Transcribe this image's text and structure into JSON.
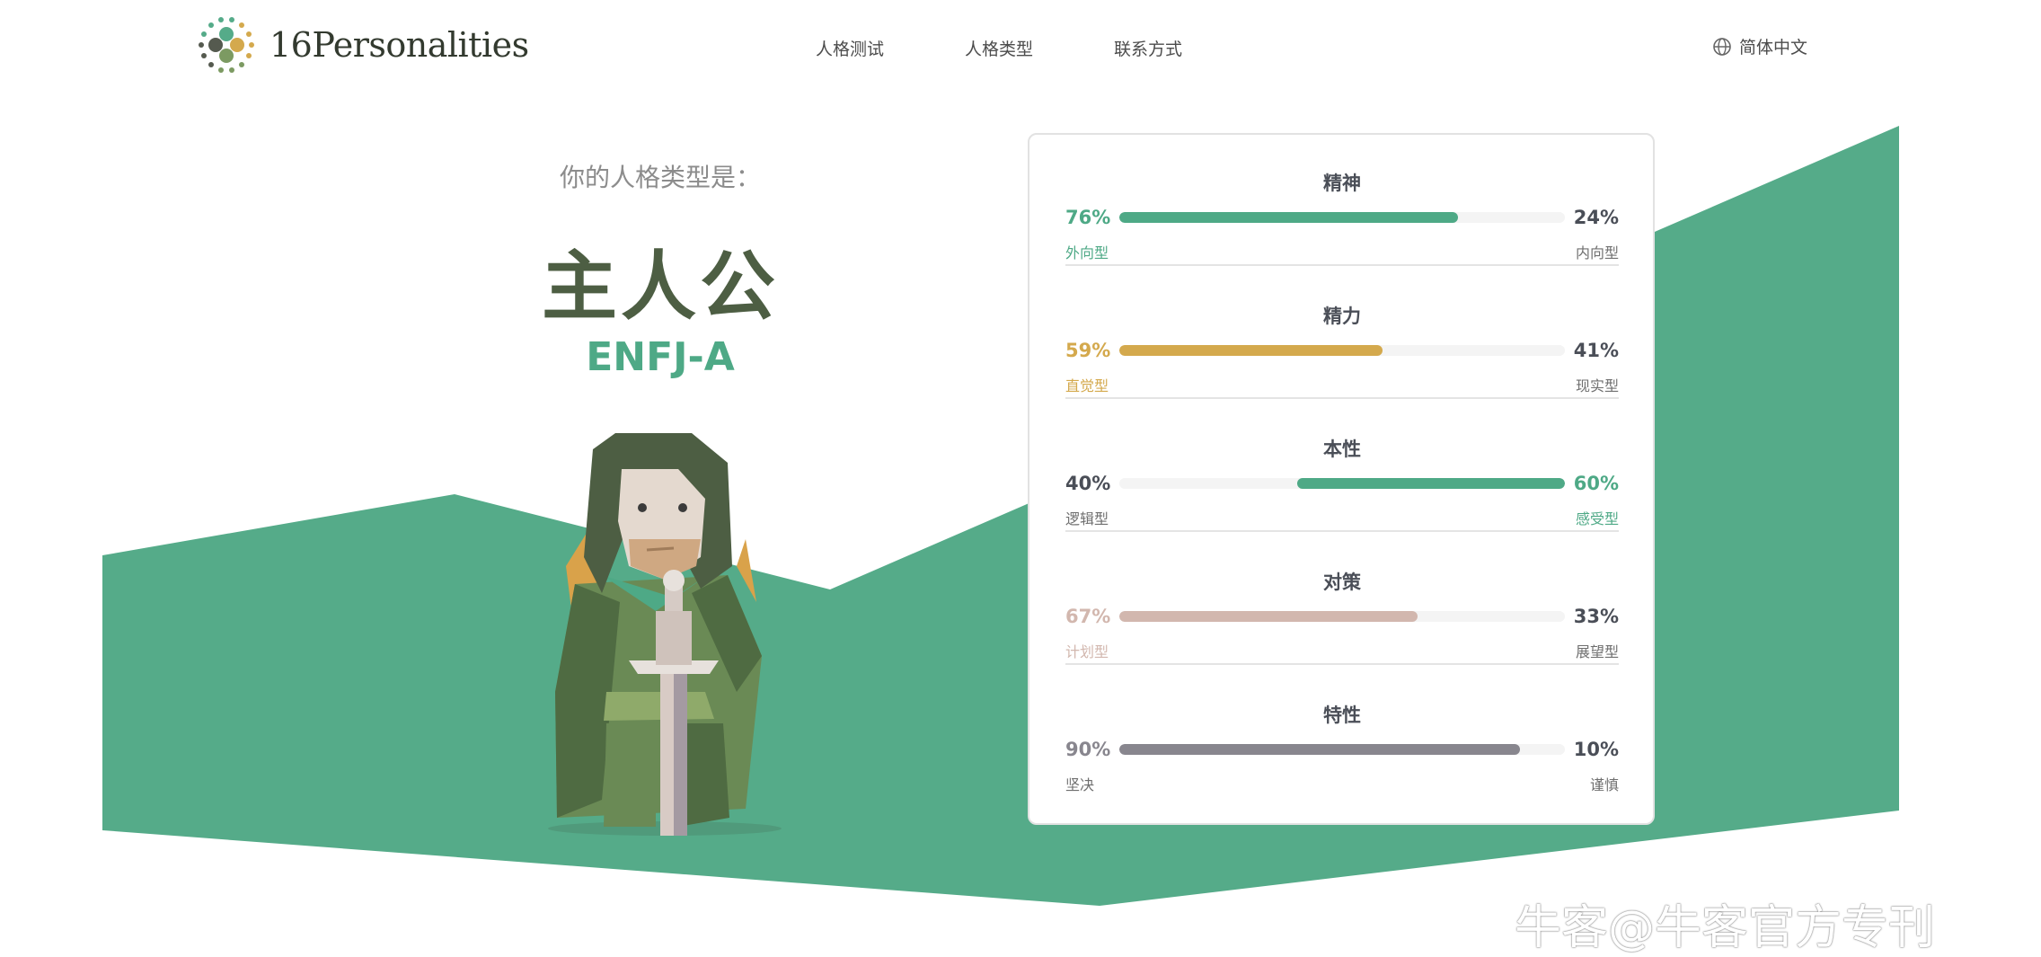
{
  "brand": {
    "logo_text": "16Personalities"
  },
  "nav": {
    "items": [
      "人格测试",
      "人格类型",
      "联系方式"
    ]
  },
  "language": {
    "label": "简体中文",
    "icon": "globe-icon"
  },
  "result": {
    "intro": "你的人格类型是：",
    "type_name": "主人公",
    "type_code": "ENFJ-A"
  },
  "traits": [
    {
      "title": "精神",
      "left_pct": "76%",
      "right_pct": "24%",
      "left_label": "外向型",
      "right_label": "内向型",
      "dominant": "left",
      "value": 0.76,
      "color": "#4ea986"
    },
    {
      "title": "精力",
      "left_pct": "59%",
      "right_pct": "41%",
      "left_label": "直觉型",
      "right_label": "现实型",
      "dominant": "left",
      "value": 0.59,
      "color": "#d4a94d"
    },
    {
      "title": "本性",
      "left_pct": "40%",
      "right_pct": "60%",
      "left_label": "逻辑型",
      "right_label": "感受型",
      "dominant": "right",
      "value": 0.6,
      "color": "#4ea986"
    },
    {
      "title": "对策",
      "left_pct": "67%",
      "right_pct": "33%",
      "left_label": "计划型",
      "right_label": "展望型",
      "dominant": "left",
      "value": 0.67,
      "color": "#d2b7ae"
    },
    {
      "title": "特性",
      "left_pct": "90%",
      "right_pct": "10%",
      "left_label": "坚决",
      "right_label": "谨慎",
      "dominant": "left",
      "value": 0.9,
      "color": "#88868e"
    }
  ],
  "watermark": {
    "text": "牛客@牛客官方专刊"
  },
  "colors": {
    "accent_green": "#4ea986",
    "mountain": "#55ab89",
    "title_dark": "#4d5e43"
  }
}
